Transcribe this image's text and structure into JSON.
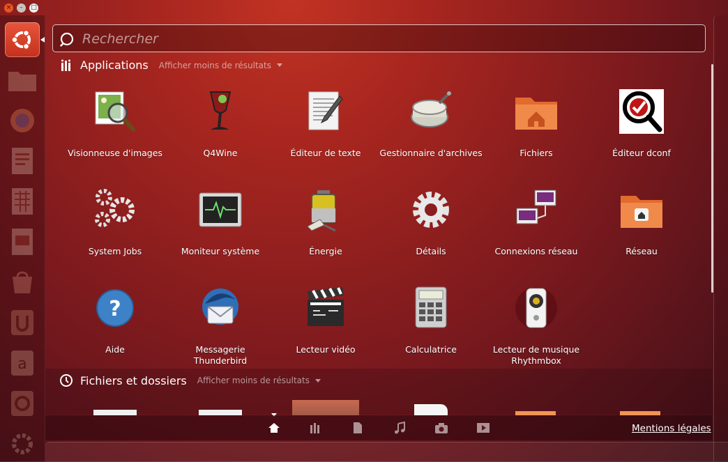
{
  "window": {
    "close": "×",
    "minimize": "–",
    "maximize": "□"
  },
  "search": {
    "placeholder": "Rechercher",
    "value": ""
  },
  "categories": {
    "applications": {
      "title": "Applications",
      "toggle": "Afficher moins de résultats"
    },
    "files": {
      "title": "Fichiers et dossiers",
      "toggle": "Afficher moins de résultats"
    }
  },
  "apps": [
    {
      "label": "Visionneuse d'images",
      "icon": "image-viewer-icon"
    },
    {
      "label": "Q4Wine",
      "icon": "q4wine-icon"
    },
    {
      "label": "Éditeur de texte",
      "icon": "text-editor-icon"
    },
    {
      "label": "Gestionnaire d'archives",
      "icon": "archive-manager-icon"
    },
    {
      "label": "Fichiers",
      "icon": "home-folder-icon"
    },
    {
      "label": "Éditeur dconf",
      "icon": "dconf-editor-icon"
    },
    {
      "label": "System Jobs",
      "icon": "gears-icon"
    },
    {
      "label": "Moniteur système",
      "icon": "system-monitor-icon"
    },
    {
      "label": "Énergie",
      "icon": "battery-icon"
    },
    {
      "label": "Détails",
      "icon": "gear-icon"
    },
    {
      "label": "Connexions réseau",
      "icon": "network-connections-icon"
    },
    {
      "label": "Réseau",
      "icon": "network-folder-icon"
    },
    {
      "label": "Aide",
      "icon": "help-icon"
    },
    {
      "label": "Messagerie Thunderbird",
      "icon": "thunderbird-icon"
    },
    {
      "label": "Lecteur vidéo",
      "icon": "clapperboard-icon"
    },
    {
      "label": "Calculatrice",
      "icon": "calculator-icon"
    },
    {
      "label": "Lecteur de musique Rhythmbox",
      "icon": "speaker-icon"
    }
  ],
  "lenses": [
    "home-lens-icon",
    "applications-lens-icon",
    "files-lens-icon",
    "music-lens-icon",
    "photos-lens-icon",
    "video-lens-icon"
  ],
  "footer": {
    "legal": "Mentions légales"
  },
  "colors": {
    "accent": "#e95420",
    "background": "#8a1d1f"
  }
}
